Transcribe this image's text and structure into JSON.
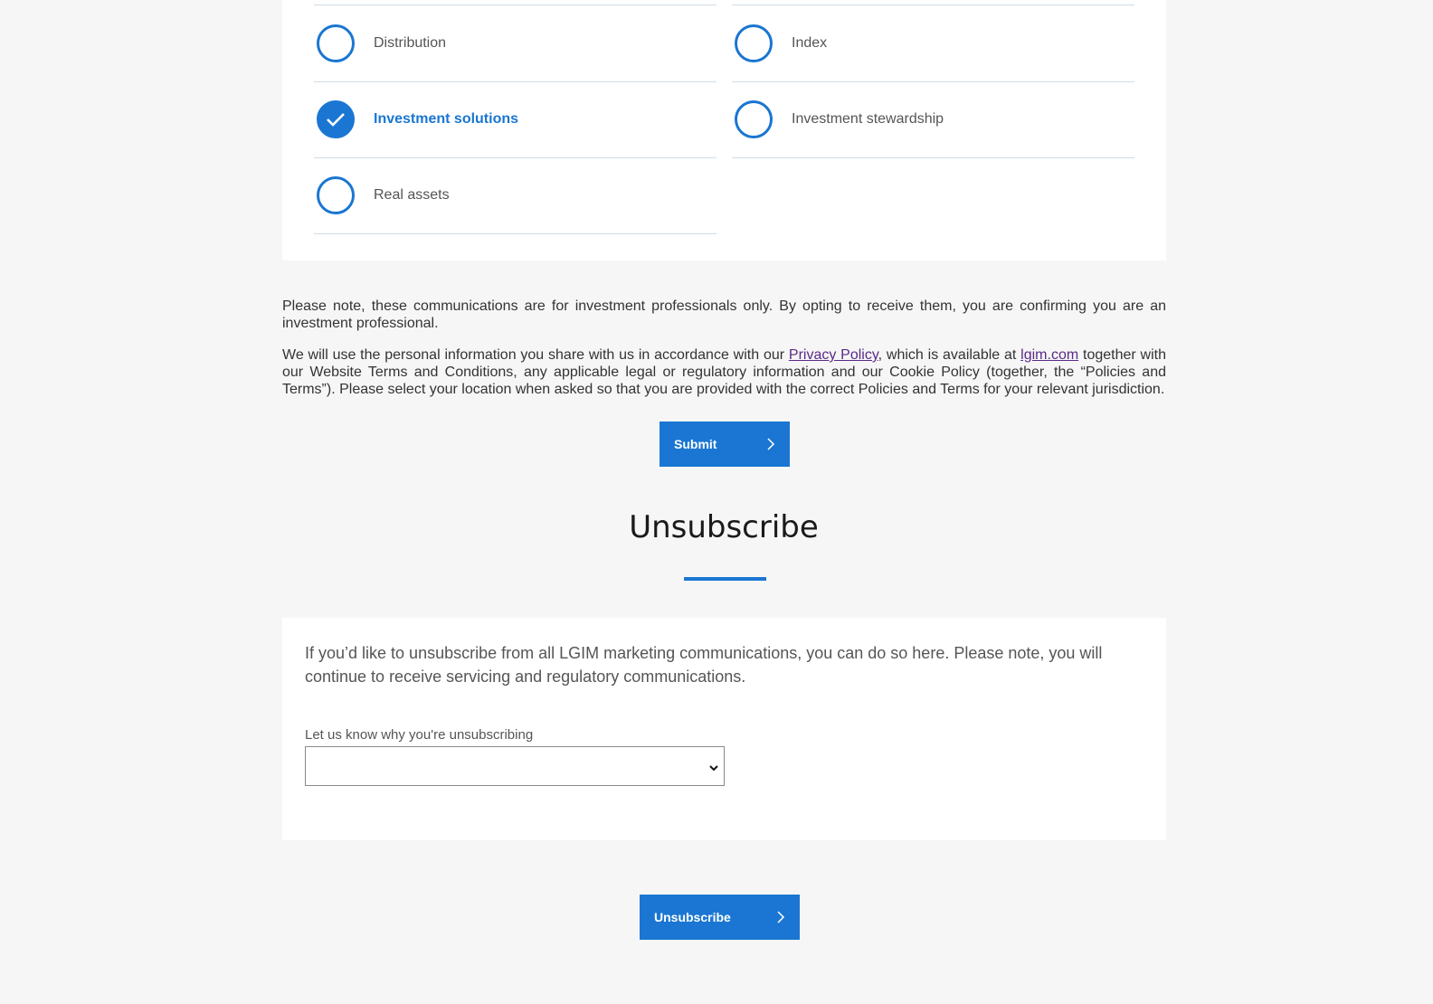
{
  "topics": [
    {
      "label": "Distribution",
      "checked": false
    },
    {
      "label": "Index",
      "checked": false
    },
    {
      "label": "Investment solutions",
      "checked": true
    },
    {
      "label": "Investment stewardship",
      "checked": false
    },
    {
      "label": "Real assets",
      "checked": false
    }
  ],
  "notice": {
    "professional_only": "Please note, these communications are for investment professionals only. By opting to receive them, you are confirming you are an investment professional.",
    "privacy_prefix": "We will use the personal information you share with us in accordance with our ",
    "privacy_link": "Privacy Policy",
    "privacy_middle": ", which is available at ",
    "site_link": "lgim.com",
    "privacy_suffix": " together with our Website Terms and Conditions, any applicable legal or regulatory information and our Cookie Policy (together, the “Policies and Terms”). Please select your location when asked so that you are provided with the correct Policies and Terms for your relevant jurisdiction."
  },
  "submit": {
    "label": "Submit"
  },
  "unsubscribe": {
    "heading": "Unsubscribe",
    "description": "If you’d like to unsubscribe from all LGIM marketing communications, you can do so here. Please note, you will continue to receive servicing and regulatory communications.",
    "reason_label": "Let us know why you're unsubscribing",
    "reason_value": "",
    "button_label": "Unsubscribe"
  },
  "colors": {
    "accent": "#1a76d2",
    "background": "#f6f6f6",
    "card": "#ffffff",
    "link_visited": "#5a2a87"
  }
}
